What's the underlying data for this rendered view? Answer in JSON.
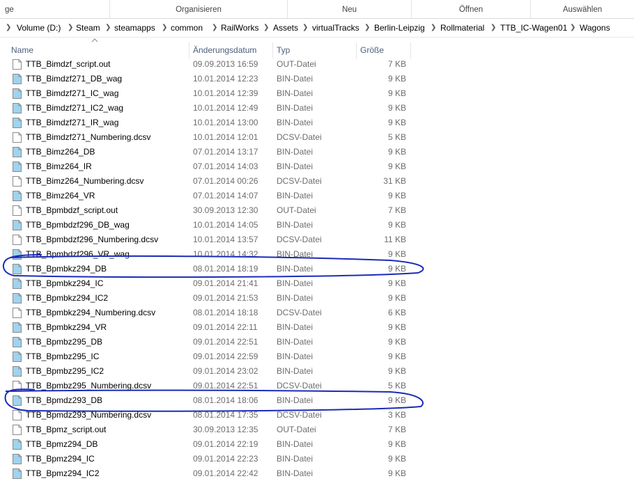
{
  "ribbon": {
    "groups": [
      "ge",
      "Organisieren",
      "Neu",
      "Öffnen",
      "Auswählen"
    ]
  },
  "breadcrumb": [
    "Volume (D:)",
    "Steam",
    "steamapps",
    "common",
    "RailWorks",
    "Assets",
    "virtualTracks",
    "Berlin-Leipzig",
    "Rollmaterial",
    "TTB_IC-Wagen01",
    "Wagons"
  ],
  "columns": {
    "name": "Name",
    "date": "Änderungsdatum",
    "type": "Typ",
    "size": "Größe"
  },
  "files": [
    {
      "name": "TTB_Bimdzf_script.out",
      "date": "09.09.2013 16:59",
      "type": "OUT-Datei",
      "size": "7 KB",
      "icon": "plain-file-icon"
    },
    {
      "name": "TTB_Bimdzf271_DB_wag",
      "date": "10.01.2014 12:23",
      "type": "BIN-Datei",
      "size": "9 KB",
      "icon": "bin-file-icon"
    },
    {
      "name": "TTB_Bimdzf271_IC_wag",
      "date": "10.01.2014 12:39",
      "type": "BIN-Datei",
      "size": "9 KB",
      "icon": "bin-file-icon"
    },
    {
      "name": "TTB_Bimdzf271_IC2_wag",
      "date": "10.01.2014 12:49",
      "type": "BIN-Datei",
      "size": "9 KB",
      "icon": "bin-file-icon"
    },
    {
      "name": "TTB_Bimdzf271_IR_wag",
      "date": "10.01.2014 13:00",
      "type": "BIN-Datei",
      "size": "9 KB",
      "icon": "bin-file-icon"
    },
    {
      "name": "TTB_Bimdzf271_Numbering.dcsv",
      "date": "10.01.2014 12:01",
      "type": "DCSV-Datei",
      "size": "5 KB",
      "icon": "plain-file-icon"
    },
    {
      "name": "TTB_Bimz264_DB",
      "date": "07.01.2014 13:17",
      "type": "BIN-Datei",
      "size": "9 KB",
      "icon": "bin-file-icon"
    },
    {
      "name": "TTB_Bimz264_IR",
      "date": "07.01.2014 14:03",
      "type": "BIN-Datei",
      "size": "9 KB",
      "icon": "bin-file-icon"
    },
    {
      "name": "TTB_Bimz264_Numbering.dcsv",
      "date": "07.01.2014 00:26",
      "type": "DCSV-Datei",
      "size": "31 KB",
      "icon": "plain-file-icon"
    },
    {
      "name": "TTB_Bimz264_VR",
      "date": "07.01.2014 14:07",
      "type": "BIN-Datei",
      "size": "9 KB",
      "icon": "bin-file-icon"
    },
    {
      "name": "TTB_Bpmbdzf_script.out",
      "date": "30.09.2013 12:30",
      "type": "OUT-Datei",
      "size": "7 KB",
      "icon": "plain-file-icon"
    },
    {
      "name": "TTB_Bpmbdzf296_DB_wag",
      "date": "10.01.2014 14:05",
      "type": "BIN-Datei",
      "size": "9 KB",
      "icon": "bin-file-icon"
    },
    {
      "name": "TTB_Bpmbdzf296_Numbering.dcsv",
      "date": "10.01.2014 13:57",
      "type": "DCSV-Datei",
      "size": "11 KB",
      "icon": "plain-file-icon"
    },
    {
      "name": "TTB_Bpmbdzf296_VR_wag",
      "date": "10.01.2014 14:32",
      "type": "BIN-Datei",
      "size": "9 KB",
      "icon": "bin-file-icon"
    },
    {
      "name": "TTB_Bpmbkz294_DB",
      "date": "08.01.2014 18:19",
      "type": "BIN-Datei",
      "size": "9 KB",
      "icon": "bin-file-icon"
    },
    {
      "name": "TTB_Bpmbkz294_IC",
      "date": "09.01.2014 21:41",
      "type": "BIN-Datei",
      "size": "9 KB",
      "icon": "bin-file-icon"
    },
    {
      "name": "TTB_Bpmbkz294_IC2",
      "date": "09.01.2014 21:53",
      "type": "BIN-Datei",
      "size": "9 KB",
      "icon": "bin-file-icon"
    },
    {
      "name": "TTB_Bpmbkz294_Numbering.dcsv",
      "date": "08.01.2014 18:18",
      "type": "DCSV-Datei",
      "size": "6 KB",
      "icon": "plain-file-icon"
    },
    {
      "name": "TTB_Bpmbkz294_VR",
      "date": "09.01.2014 22:11",
      "type": "BIN-Datei",
      "size": "9 KB",
      "icon": "bin-file-icon"
    },
    {
      "name": "TTB_Bpmbz295_DB",
      "date": "09.01.2014 22:51",
      "type": "BIN-Datei",
      "size": "9 KB",
      "icon": "bin-file-icon"
    },
    {
      "name": "TTB_Bpmbz295_IC",
      "date": "09.01.2014 22:59",
      "type": "BIN-Datei",
      "size": "9 KB",
      "icon": "bin-file-icon"
    },
    {
      "name": "TTB_Bpmbz295_IC2",
      "date": "09.01.2014 23:02",
      "type": "BIN-Datei",
      "size": "9 KB",
      "icon": "bin-file-icon"
    },
    {
      "name": "TTB_Bpmbz295_Numbering.dcsv",
      "date": "09.01.2014 22:51",
      "type": "DCSV-Datei",
      "size": "5 KB",
      "icon": "plain-file-icon"
    },
    {
      "name": "TTB_Bpmdz293_DB",
      "date": "08.01.2014 18:06",
      "type": "BIN-Datei",
      "size": "9 KB",
      "icon": "bin-file-icon"
    },
    {
      "name": "TTB_Bpmdz293_Numbering.dcsv",
      "date": "08.01.2014 17:35",
      "type": "DCSV-Datei",
      "size": "3 KB",
      "icon": "plain-file-icon"
    },
    {
      "name": "TTB_Bpmz_script.out",
      "date": "30.09.2013 12:35",
      "type": "OUT-Datei",
      "size": "7 KB",
      "icon": "plain-file-icon"
    },
    {
      "name": "TTB_Bpmz294_DB",
      "date": "09.01.2014 22:19",
      "type": "BIN-Datei",
      "size": "9 KB",
      "icon": "bin-file-icon"
    },
    {
      "name": "TTB_Bpmz294_IC",
      "date": "09.01.2014 22:23",
      "type": "BIN-Datei",
      "size": "9 KB",
      "icon": "bin-file-icon"
    },
    {
      "name": "TTB_Bpmz294_IC2",
      "date": "09.01.2014 22:42",
      "type": "BIN-Datei",
      "size": "9 KB",
      "icon": "bin-file-icon"
    }
  ],
  "colors": {
    "annotation": "#1a2bb8",
    "header_text": "#4c607a",
    "meta_text": "#6d6d6d",
    "bin_icon": "#9fd3ee"
  }
}
